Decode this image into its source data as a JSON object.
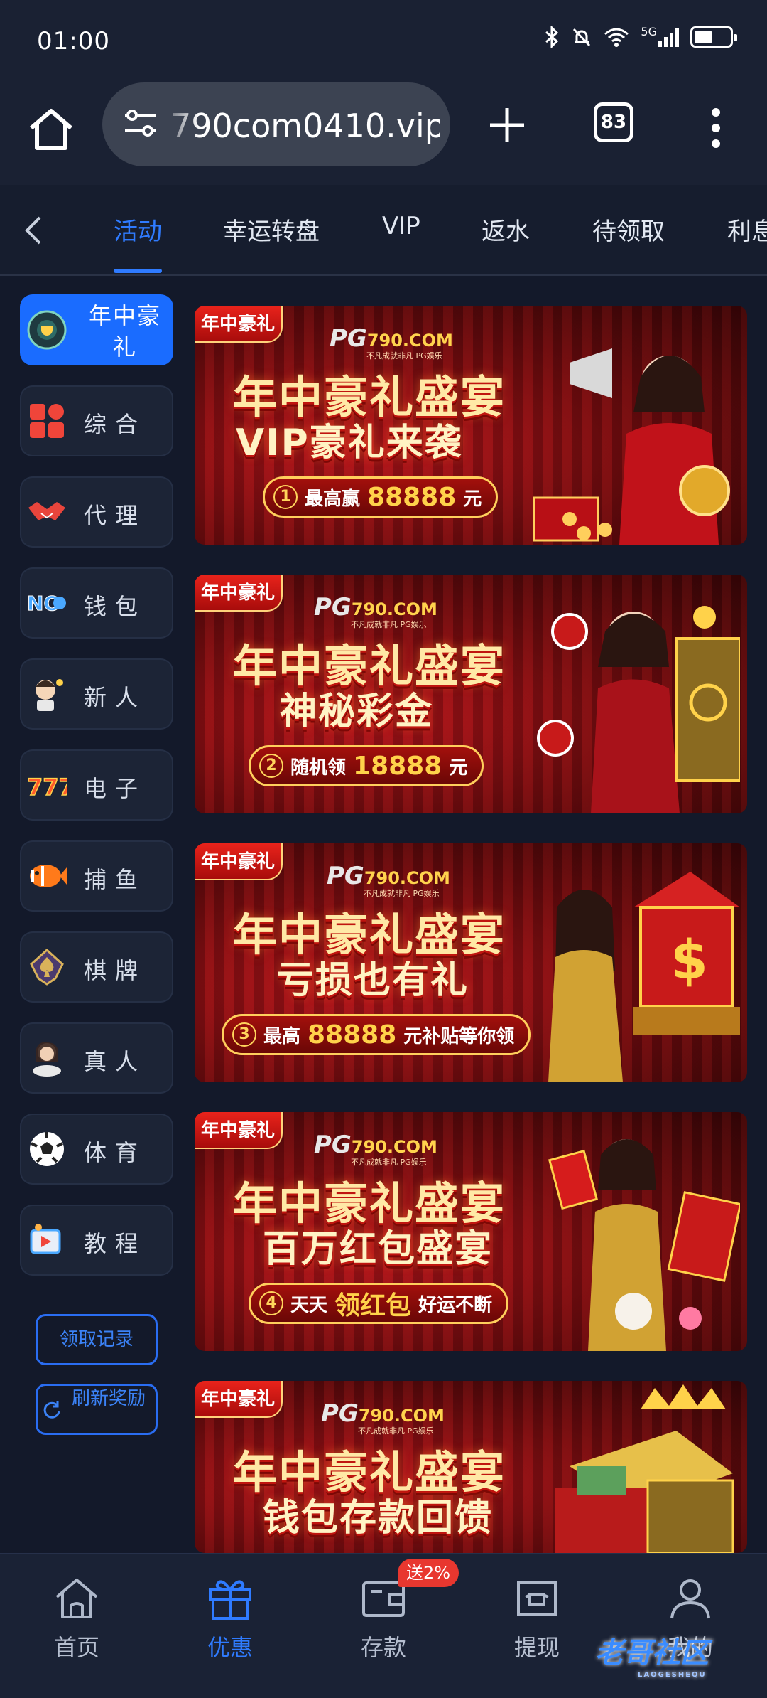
{
  "status": {
    "time": "01:00",
    "network": "5G"
  },
  "browser": {
    "url": "790com0410.vip",
    "tab_count": "83"
  },
  "tabs": [
    "活动",
    "幸运转盘",
    "VIP",
    "返水",
    "待领取",
    "利息"
  ],
  "sidebar": {
    "items": [
      {
        "label": "年中豪礼",
        "icon": "trophy-icon"
      },
      {
        "label": "综合",
        "icon": "grid-icon"
      },
      {
        "label": "代理",
        "icon": "handshake-icon"
      },
      {
        "label": "钱包",
        "icon": "wallet-brand-icon"
      },
      {
        "label": "新人",
        "icon": "newbie-icon"
      },
      {
        "label": "电子",
        "icon": "slot-777-icon"
      },
      {
        "label": "捕鱼",
        "icon": "fish-icon"
      },
      {
        "label": "棋牌",
        "icon": "spade-icon"
      },
      {
        "label": "真人",
        "icon": "live-dealer-icon"
      },
      {
        "label": "体育",
        "icon": "soccer-ball-icon"
      },
      {
        "label": "教程",
        "icon": "video-tutorial-icon"
      }
    ],
    "claim_record": "领取记录",
    "refresh_reward": "刷新奖励"
  },
  "banners": [
    {
      "tag": "年中豪礼",
      "brand_pg": "PG",
      "brand_domain": "790.COM",
      "brand_sub": "不凡成就非凡 PG娱乐",
      "headline": "年中豪礼盛宴",
      "subtitle": "VIP豪礼来袭",
      "num": "1",
      "pill_pre": "最高赢",
      "pill_amount": "88888",
      "pill_post": "元"
    },
    {
      "tag": "年中豪礼",
      "brand_pg": "PG",
      "brand_domain": "790.COM",
      "brand_sub": "不凡成就非凡 PG娱乐",
      "headline": "年中豪礼盛宴",
      "subtitle": "神秘彩金",
      "num": "2",
      "pill_pre": "随机领",
      "pill_amount": "18888",
      "pill_post": "元"
    },
    {
      "tag": "年中豪礼",
      "brand_pg": "PG",
      "brand_domain": "790.COM",
      "brand_sub": "不凡成就非凡 PG娱乐",
      "headline": "年中豪礼盛宴",
      "subtitle": "亏损也有礼",
      "num": "3",
      "pill_pre": "最高",
      "pill_amount": "88888",
      "pill_post": "元补贴等你领"
    },
    {
      "tag": "年中豪礼",
      "brand_pg": "PG",
      "brand_domain": "790.COM",
      "brand_sub": "不凡成就非凡 PG娱乐",
      "headline": "年中豪礼盛宴",
      "subtitle": "百万红包盛宴",
      "num": "4",
      "pill_pre": "天天",
      "pill_amount": "领红包",
      "pill_post": "好运不断"
    },
    {
      "tag": "年中豪礼",
      "brand_pg": "PG",
      "brand_domain": "790.COM",
      "brand_sub": "不凡成就非凡 PG娱乐",
      "headline": "年中豪礼盛宴",
      "subtitle": "钱包存款回馈"
    }
  ],
  "bottom_nav": [
    {
      "label": "首页",
      "icon": "home-icon"
    },
    {
      "label": "优惠",
      "icon": "gift-icon"
    },
    {
      "label": "存款",
      "icon": "deposit-wallet-icon",
      "badge": "送2%"
    },
    {
      "label": "提现",
      "icon": "withdraw-icon"
    },
    {
      "label": "我的",
      "icon": "profile-icon"
    }
  ],
  "watermark": {
    "text": "老哥社区",
    "sub": "LAOGESHEQU"
  },
  "colors": {
    "accent": "#2f7bff",
    "background": "#13192a",
    "banner_red": "#b3141a",
    "badge": "#e8372f"
  }
}
